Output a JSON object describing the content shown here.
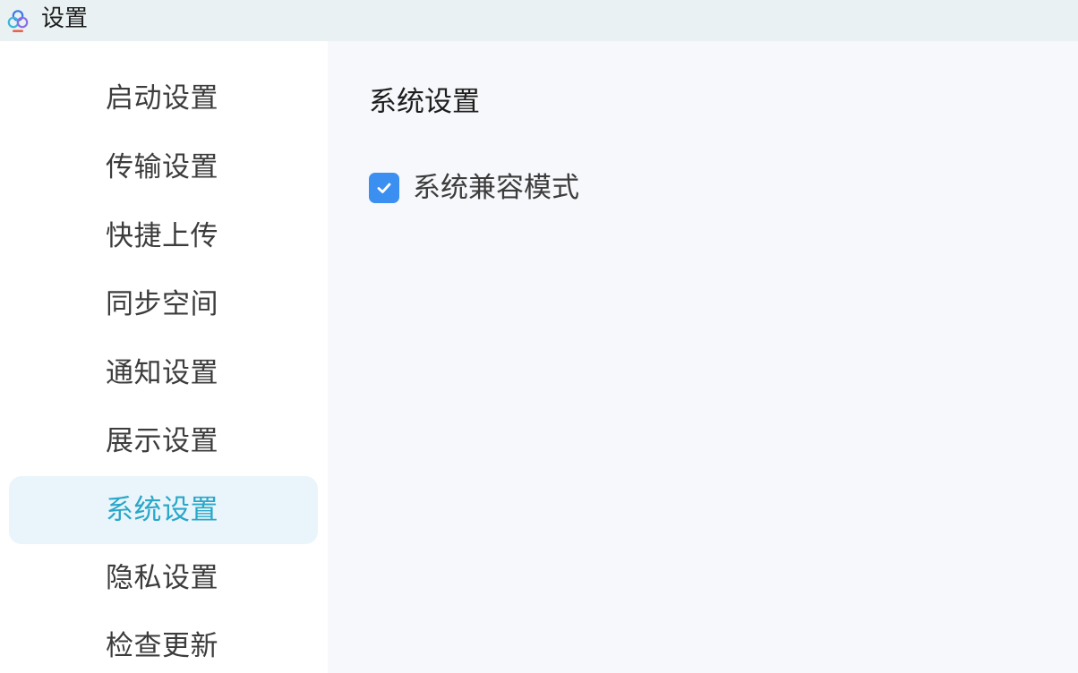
{
  "window": {
    "title": "设置"
  },
  "sidebar": {
    "items": [
      {
        "label": "启动设置",
        "active": false
      },
      {
        "label": "传输设置",
        "active": false
      },
      {
        "label": "快捷上传",
        "active": false
      },
      {
        "label": "同步空间",
        "active": false
      },
      {
        "label": "通知设置",
        "active": false
      },
      {
        "label": "展示设置",
        "active": false
      },
      {
        "label": "系统设置",
        "active": true
      },
      {
        "label": "隐私设置",
        "active": false
      },
      {
        "label": "检查更新",
        "active": false
      }
    ]
  },
  "main": {
    "section_title": "系统设置",
    "compat_mode": {
      "label": "系统兼容模式",
      "checked": true
    }
  },
  "colors": {
    "accent": "#2aa7c8",
    "checkbox": "#3a8ff0",
    "active_bg": "#e9f5fb",
    "titlebar_bg": "#e9f1f2"
  }
}
